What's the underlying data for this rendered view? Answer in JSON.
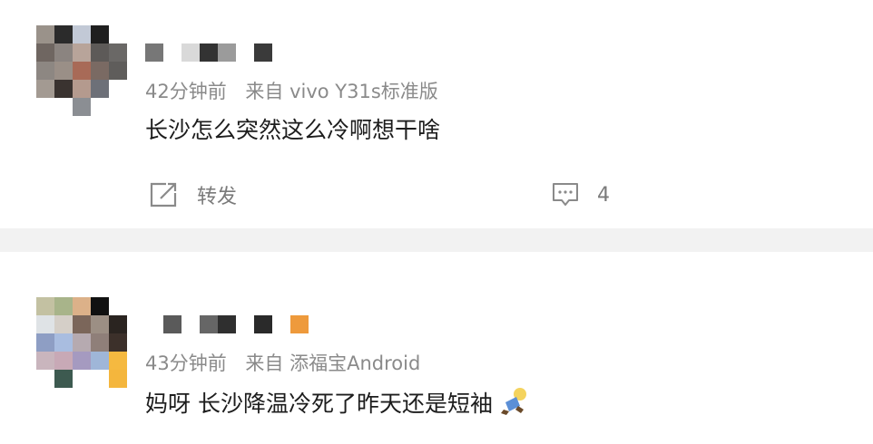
{
  "comments": [
    {
      "time": "42分钟前",
      "source": "来自 vivo Y31s标准版",
      "text": "长沙怎么突然这么冷啊想干啥",
      "actions": {
        "repost_label": "转发",
        "comment_count": "4"
      },
      "avatar_colors": [
        [
          "#9a928a",
          "#2b2b2b",
          "#c2c9d6",
          "#1f1f1f",
          "#ffffff"
        ],
        [
          "#6f6661",
          "#8b8480",
          "#b8a49a",
          "#5d5a58",
          "#6a6866"
        ],
        [
          "#8d8782",
          "#9a8f87",
          "#a86a57",
          "#7a6a63",
          "#5f5d5b"
        ],
        [
          "#a39a92",
          "#3a3330",
          "#b49a8e",
          "#6d7078",
          "#ffffff"
        ],
        [
          "#ffffff",
          "#ffffff",
          "#8b8e93",
          "#ffffff",
          "#ffffff"
        ]
      ],
      "name_blocks": [
        "#777777",
        "#d9d9d9",
        "#333333",
        "#9b9b9b",
        "#3a3a3a"
      ]
    },
    {
      "time": "43分钟前",
      "source": "来自 添福宝Android",
      "text": "妈呀 长沙降温冷死了昨天还是短袖",
      "emoji": "person-in-blue-emoji",
      "avatar_colors": [
        [
          "#c3c1a2",
          "#a8b48a",
          "#dcb189",
          "#111111",
          "#ffffff"
        ],
        [
          "#dfe3e6",
          "#d5cfc8",
          "#7b665a",
          "#9c8f84",
          "#2a2420"
        ],
        [
          "#8e9ec4",
          "#a9bde0",
          "#b6aab0",
          "#8f7f79",
          "#3c302a"
        ],
        [
          "#c9b5bd",
          "#c8a9b6",
          "#a59ac0",
          "#9fb6d8",
          "#f5b940"
        ],
        [
          "#ffffff",
          "#3d5a50",
          "#ffffff",
          "#ffffff",
          "#f4b63d"
        ]
      ],
      "name_blocks": [
        "#5a5a5a",
        "#666666",
        "#2f2f2f",
        "#2a2a2a",
        "#ee9a3c"
      ]
    }
  ]
}
